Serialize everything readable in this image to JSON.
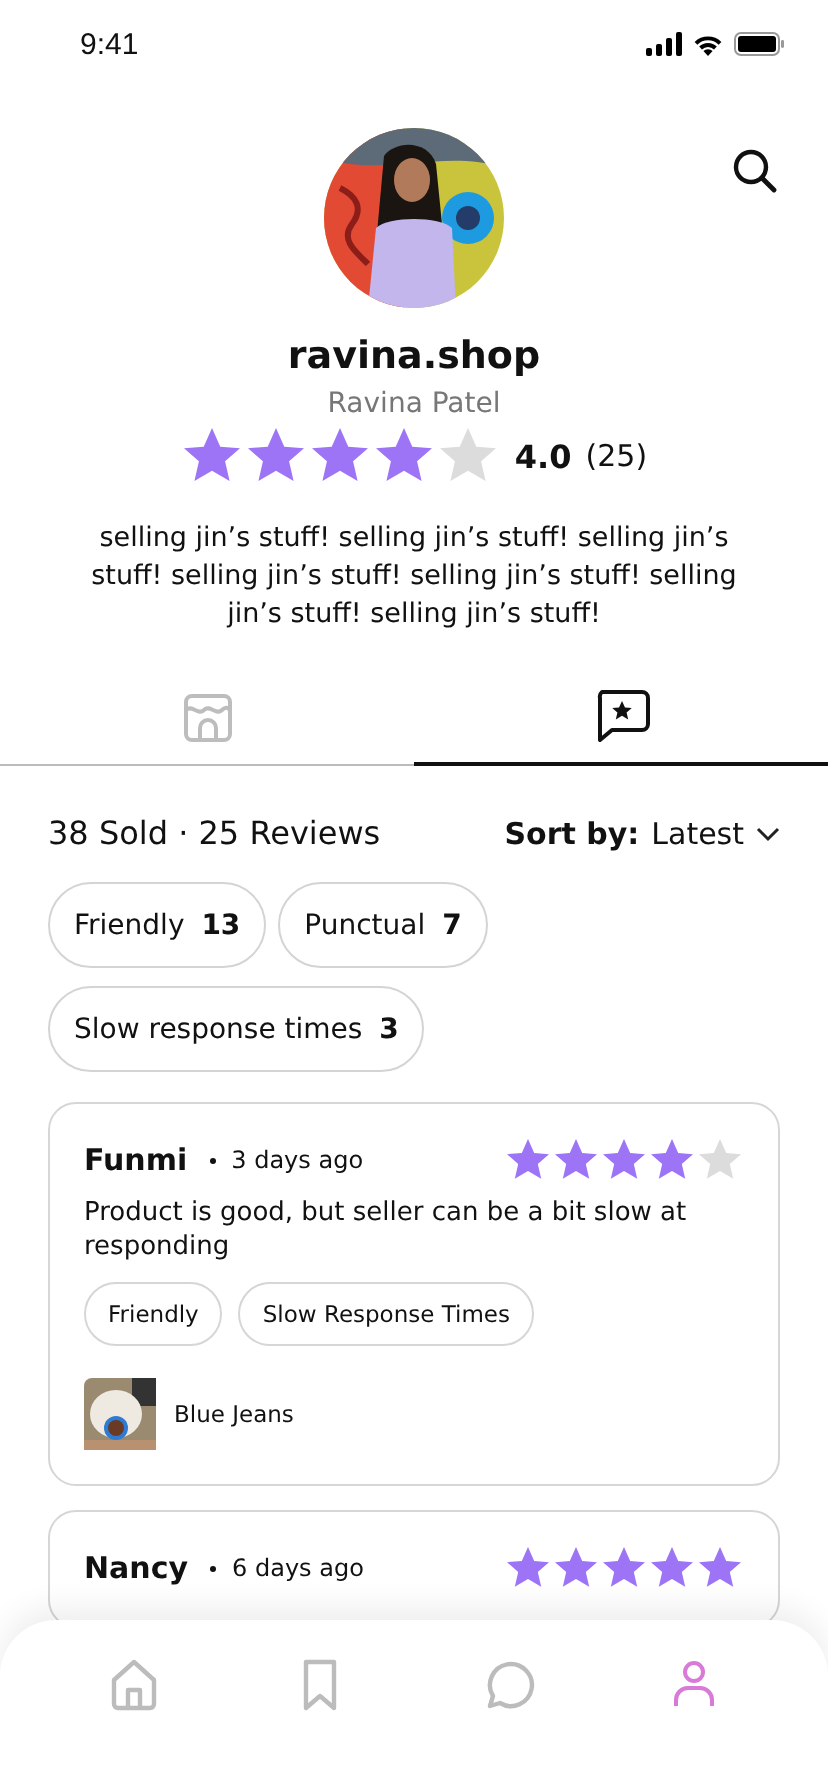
{
  "status_bar": {
    "time": "9:41"
  },
  "profile": {
    "username": "ravina.shop",
    "name": "Ravina Patel",
    "stars": 4,
    "rating": "4.0",
    "count": "(25)",
    "bio": "selling jin’s stuff! selling jin’s stuff! selling jin’s stuff! selling jin’s stuff! selling jin’s stuff! selling jin’s stuff! selling jin’s stuff!"
  },
  "tabs": [
    {
      "kind": "shop",
      "selected": false
    },
    {
      "kind": "reviews",
      "selected": true
    }
  ],
  "summary": {
    "text": "38 Sold · 25 Reviews",
    "sort_label": "Sort by:",
    "sort_value": "Latest"
  },
  "tags": [
    {
      "label": "Friendly",
      "count": "13"
    },
    {
      "label": "Punctual",
      "count": "7"
    },
    {
      "label": "Slow response times",
      "count": "3"
    }
  ],
  "reviews": [
    {
      "author": "Funmi",
      "time": "3 days ago",
      "stars": 4,
      "text": "Product is good, but seller can be a bit slow at responding",
      "tags": [
        "Friendly",
        "Slow Response Times"
      ],
      "product": "Blue Jeans"
    },
    {
      "author": "Nancy",
      "time": "6 days ago",
      "stars": 5
    }
  ],
  "nav": [
    {
      "kind": "home",
      "selected": false
    },
    {
      "kind": "bookmark",
      "selected": false
    },
    {
      "kind": "chat",
      "selected": false
    },
    {
      "kind": "profile",
      "selected": true
    }
  ]
}
